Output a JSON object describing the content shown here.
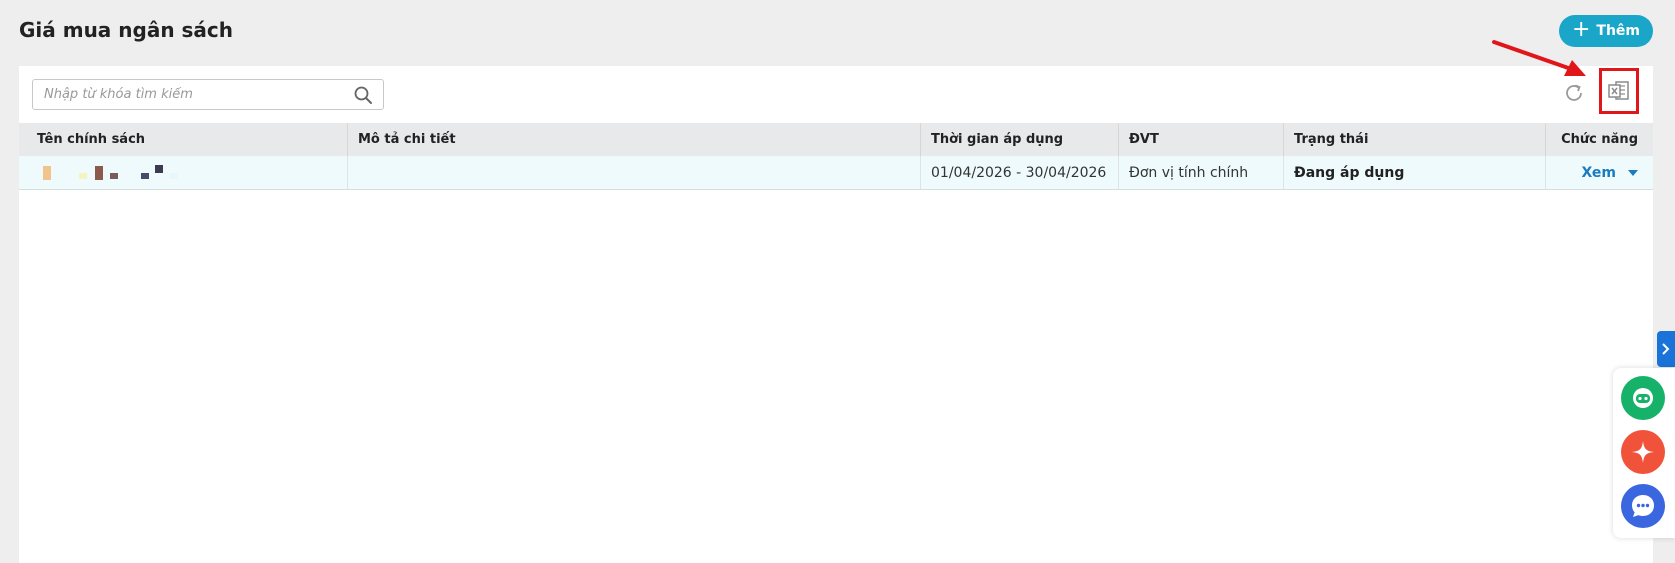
{
  "page": {
    "title": "Giá mua ngân sách"
  },
  "toolbar": {
    "add_label": "Thêm"
  },
  "search": {
    "placeholder": "Nhập từ khóa tìm kiếm"
  },
  "table": {
    "headers": [
      "Tên chính sách",
      "Mô tả chi tiết",
      "Thời gian áp dụng",
      "ĐVT",
      "Trạng thái",
      "Chức năng"
    ],
    "rows": [
      {
        "name": "",
        "description": "",
        "period": "01/04/2026 - 30/04/2026",
        "unit": "Đơn vị tính chính",
        "status": "Đang áp dụng",
        "action": "Xem"
      }
    ]
  },
  "colors": {
    "accent": "#1aa6c9",
    "highlight": "#e0161b",
    "link": "#1a7bbf",
    "row_bg": "#effafd"
  },
  "icons": {
    "search": "search-icon",
    "refresh": "refresh-icon",
    "export": "excel-export-icon",
    "chat_bot": "robot-icon",
    "ai": "sparkle-icon",
    "messages": "chat-bubble-icon"
  }
}
